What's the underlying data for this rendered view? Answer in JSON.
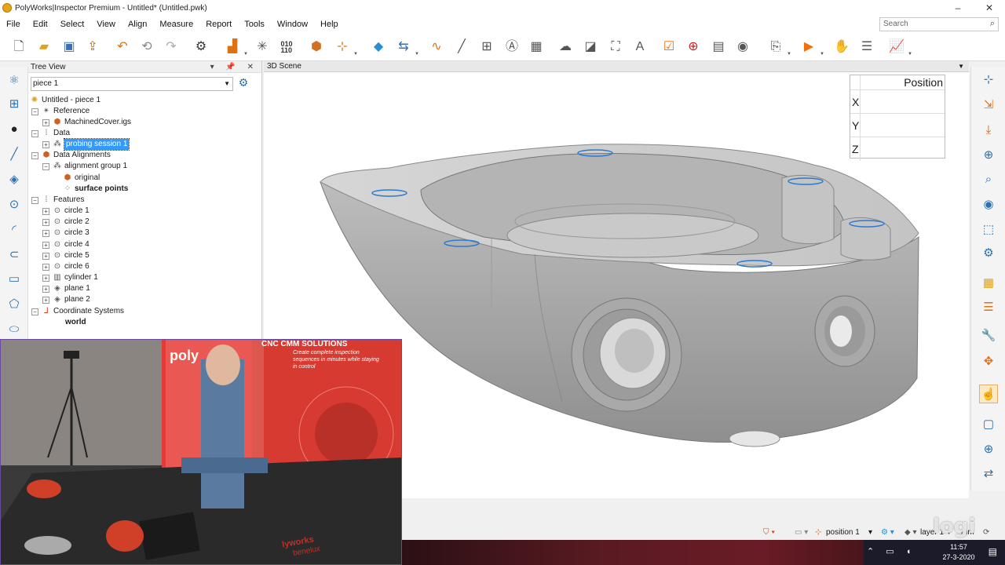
{
  "window": {
    "title": "PolyWorks|Inspector Premium - Untitled* (Untitled.pwk)",
    "min": "–",
    "close": "✕"
  },
  "menu": [
    "File",
    "Edit",
    "Select",
    "View",
    "Align",
    "Measure",
    "Report",
    "Tools",
    "Window",
    "Help"
  ],
  "search": {
    "placeholder": "Search"
  },
  "tree_view": {
    "title": "Tree View",
    "header_buttons": "▾ 📌 ✕",
    "piece": "piece 1",
    "root": "Untitled - piece 1",
    "items": [
      {
        "label": "Reference"
      },
      {
        "label": "MachinedCover.igs"
      },
      {
        "label": "Data"
      },
      {
        "label": "probing session 1"
      },
      {
        "label": "Data Alignments"
      },
      {
        "label": "alignment group 1"
      },
      {
        "label": "original"
      },
      {
        "label": "surface points"
      },
      {
        "label": "Features"
      },
      {
        "label": "circle 1"
      },
      {
        "label": "circle 2"
      },
      {
        "label": "circle 3"
      },
      {
        "label": "circle 4"
      },
      {
        "label": "circle 5"
      },
      {
        "label": "circle 6"
      },
      {
        "label": "cylinder 1"
      },
      {
        "label": "plane 1"
      },
      {
        "label": "plane 2"
      },
      {
        "label": "Coordinate Systems"
      },
      {
        "label": "world"
      }
    ]
  },
  "scene": {
    "title": "3D Scene",
    "position_table": {
      "header": "Position",
      "x_label": "X",
      "y_label": "Y",
      "z_label": "Z"
    }
  },
  "webcam_banner": {
    "brand": "poly",
    "headline": "CNC CMM SOLUTIONS",
    "tagline": "Create complete inspection sequences in minutes while staying in control",
    "footer_brand": "lyworks",
    "footer_sub": "benelux"
  },
  "status": {
    "position": "position 1",
    "layer": "layer 1",
    "unit": "mm"
  },
  "taskbar": {
    "time": "11:57",
    "date": "27-3-2020"
  },
  "watermark": "logi"
}
